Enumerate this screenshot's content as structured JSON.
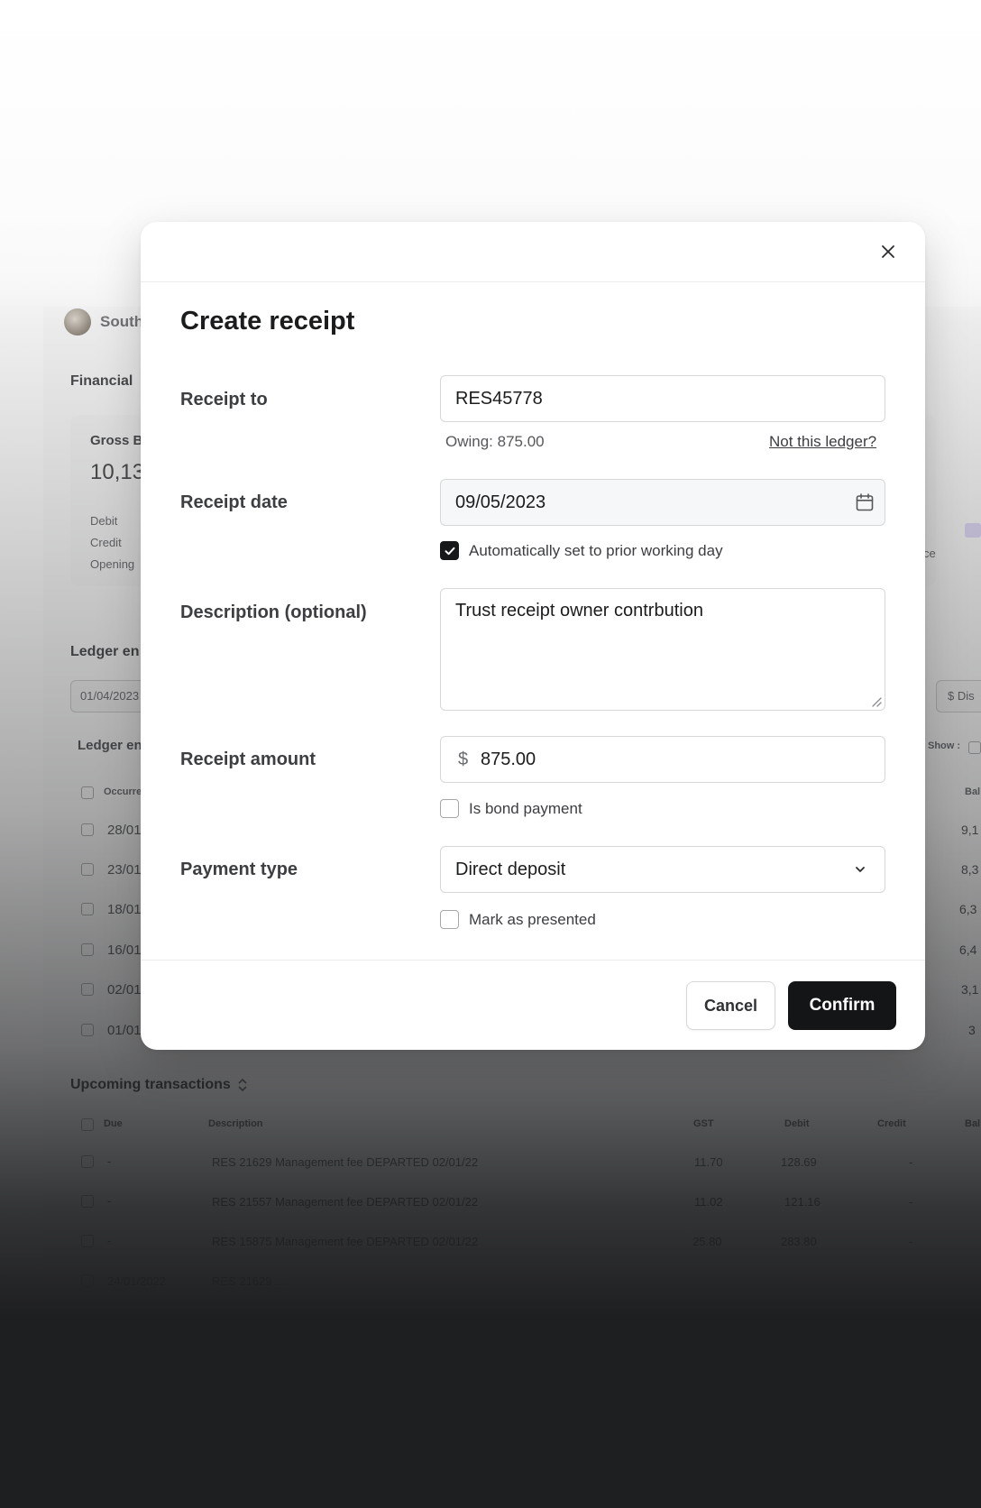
{
  "background": {
    "app_name": "South",
    "financial_heading": "Financial",
    "gross_label": "Gross B",
    "gross_value": "10,13",
    "debit_label": "Debit",
    "credit_label": "Credit",
    "opening_label": "Opening",
    "side_label": "ce",
    "ledger_heading": "Ledger en",
    "date_filter": "01/04/2023",
    "dis_filter": "$ Dis",
    "ledger_sub": "Ledger en",
    "show_label": "Show :",
    "col_occurred": "Occurre",
    "col_balance": "Bal",
    "ledger_rows": [
      {
        "date": "28/01/",
        "balance": "9,1"
      },
      {
        "date": "23/01/",
        "balance": "8,3"
      },
      {
        "date": "18/01/",
        "balance": "6,3"
      },
      {
        "date": "16/01/",
        "balance": "6,4"
      },
      {
        "date": "02/01/",
        "balance": "3,1"
      },
      {
        "date": "01/01/",
        "balance": "3"
      }
    ],
    "upcoming": {
      "heading": "Upcoming transactions",
      "headers": {
        "due": "Due",
        "description": "Description",
        "gst": "GST",
        "debit": "Debit",
        "credit": "Credit",
        "balance": "Bal"
      },
      "rows": [
        {
          "due": "-",
          "description": "RES 21629 Management fee DEPARTED 02/01/22",
          "gst": "11.70",
          "debit": "128.69",
          "credit": "-"
        },
        {
          "due": "-",
          "description": "RES 21557 Management fee DEPARTED 02/01/22",
          "gst": "11.02",
          "debit": "121.16",
          "credit": "-"
        },
        {
          "due": "-",
          "description": "RES 15875 Management fee DEPARTED 02/01/22",
          "gst": "25.80",
          "debit": "283.80",
          "credit": "-"
        },
        {
          "due": "24/01/2022",
          "description": "RES 21629 ...",
          "gst": "",
          "debit": "",
          "credit": ""
        }
      ]
    }
  },
  "modal": {
    "title": "Create receipt",
    "receipt_to": {
      "label": "Receipt to",
      "value": "RES45778",
      "owing": "Owing: 875.00",
      "link": "Not this ledger?"
    },
    "receipt_date": {
      "label": "Receipt date",
      "value": "09/05/2023",
      "auto_label": "Automatically set to prior working day",
      "auto_checked": true
    },
    "description": {
      "label": "Description (optional)",
      "value": "Trust receipt owner contrbution"
    },
    "amount": {
      "label": "Receipt amount",
      "currency": "$",
      "value": "875.00",
      "bond_label": "Is bond payment",
      "bond_checked": false
    },
    "payment_type": {
      "label": "Payment type",
      "value": "Direct deposit",
      "presented_label": "Mark as presented",
      "presented_checked": false
    },
    "buttons": {
      "cancel": "Cancel",
      "confirm": "Confirm"
    }
  },
  "icons": [
    "close-icon",
    "calendar-icon",
    "chevron-down-icon",
    "check-icon",
    "resize-grip-icon",
    "sort-icon"
  ],
  "colors": {
    "primary_button": "#141517",
    "checkbox_checked": "#17181a",
    "border": "#d6d7d9"
  }
}
